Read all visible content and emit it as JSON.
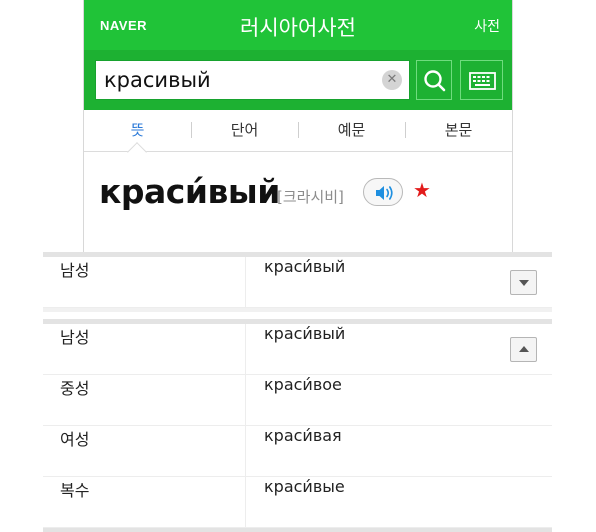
{
  "header": {
    "brand": "NAVER",
    "title": "러시아어사전",
    "dictionary_link": "사전"
  },
  "search": {
    "value": "красивый",
    "clear_icon": "close-icon",
    "search_icon": "search-icon",
    "keyboard_icon": "keyboard-icon"
  },
  "tabs": [
    {
      "label": "뜻",
      "active": true
    },
    {
      "label": "단어",
      "active": false
    },
    {
      "label": "예문",
      "active": false
    },
    {
      "label": "본문",
      "active": false
    }
  ],
  "entry": {
    "headword": "краси́вый",
    "pronunciation": "[크라시비]",
    "sound_icon": "speaker-icon",
    "favorite_icon": "star-icon",
    "favorite_color": "#e21b1b"
  },
  "collapsed_table": {
    "row": {
      "gender": "남성",
      "form": "краси́вый"
    },
    "toggle_icon": "chevron-down-icon"
  },
  "expanded_table": {
    "toggle_icon": "chevron-up-icon",
    "rows": [
      {
        "gender": "남성",
        "form": "краси́вый"
      },
      {
        "gender": "중성",
        "form": "краси́вое"
      },
      {
        "gender": "여성",
        "form": "краси́вая"
      },
      {
        "gender": "복수",
        "form": "краси́вые"
      }
    ]
  },
  "colors": {
    "brand_green": "#20c338",
    "searchbar_green": "#1db132",
    "active_tab_blue": "#2b7ad8"
  }
}
